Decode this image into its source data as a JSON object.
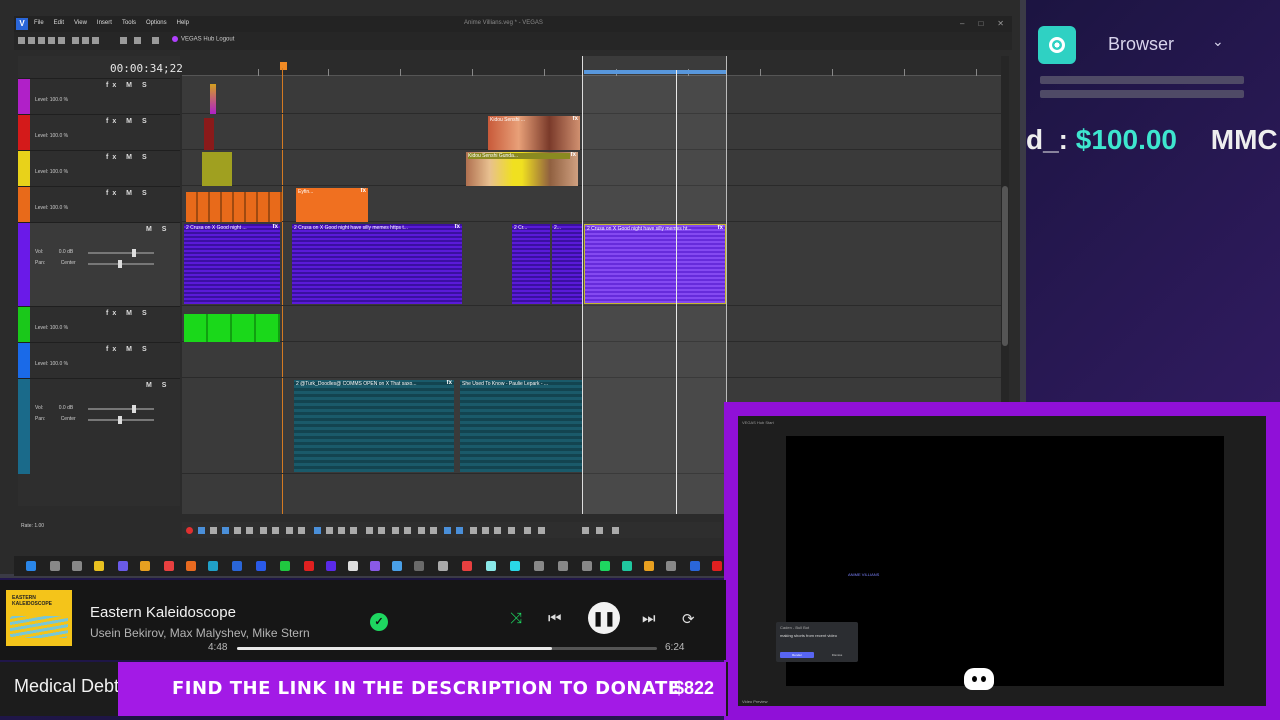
{
  "vegas": {
    "app_icon": "V",
    "menu": [
      "File",
      "Edit",
      "View",
      "Insert",
      "Tools",
      "Options",
      "Help"
    ],
    "window_title": "Anime Villians.veg * - VEGAS",
    "hub_label": "VEGAS Hub Logout",
    "timecode": "00:00:34;22",
    "rate_label": "Rate: 1.00",
    "video_tracks": [
      {
        "level": "Level: 100.0 %",
        "color": "#b020c8"
      },
      {
        "level": "Level: 100.0 %",
        "color": "#d41a1a"
      },
      {
        "level": "Level: 100.0 %",
        "color": "#e8d21a"
      },
      {
        "level": "Level: 100.0 %",
        "color": "#e86a1a"
      }
    ],
    "audio_track_1": {
      "vol": "Vol:",
      "vol_value": "0.0 dB",
      "pan": "Pan:",
      "pan_value": "Center",
      "color": "#6a1ae8"
    },
    "video_tracks_2": [
      {
        "level": "Level: 100.0 %",
        "color": "#1ac81a"
      },
      {
        "level": "Level: 100.0 %",
        "color": "#1a6ae8"
      }
    ],
    "audio_track_2": {
      "vol": "Vol:",
      "vol_value": "0.0 dB",
      "pan": "Pan:",
      "pan_value": "Center",
      "color": "#1a6a8a"
    },
    "track_controls_video": "fx M S",
    "track_controls_audio": "M S",
    "clips": {
      "kidou": "Kidou Senshi ...",
      "kidou2": "Kidou Senshi Gunda...",
      "eyfin": "Eyfin...",
      "crusa_1": "2 Crusa on X Good night ...",
      "crusa_2": "2 Crusa on X Good night have silly memes https t...",
      "crusa_3": "2 Cr...",
      "crusa_4": "2...",
      "crusa_5": "2 Crusa on X Good night have silly memes ht...",
      "turk": "2 @Turk_Doodles@ COMMS OPEN on X That saxo...",
      "she_used": "She Used To Know - Paulie Lepark - ..."
    },
    "fx_label": "fx"
  },
  "browser_widget": {
    "label": "Browser",
    "donation_name": "d_:",
    "donation_amount": "$100.00",
    "next_text": "MMC"
  },
  "preview": {
    "title": "VEGAS Hub Start",
    "overlay_text": "ANIME  VILLIANS",
    "dialog_title": "Caden - Bull Bot",
    "dialog_msg": "making shorts from recent video",
    "dialog_btn_primary": "Render",
    "dialog_btn_secondary": "Dismiss",
    "footer_text": "Video Preview"
  },
  "player": {
    "album_text": "EASTERN KALEIDOSCOPE",
    "title": "Eastern Kaleidoscope",
    "artists": "Usein Bekirov, Max Malyshev, Mike Stern",
    "time_current": "4:48",
    "time_total": "6:24",
    "progress_fraction": 0.75,
    "accent": "#1ed760"
  },
  "ticker": {
    "name": "Medical Debt",
    "message": "FIND THE LINK IN THE DESCRIPTION TO DONATE",
    "amount": "$822",
    "bar_color": "#a31ae6"
  }
}
